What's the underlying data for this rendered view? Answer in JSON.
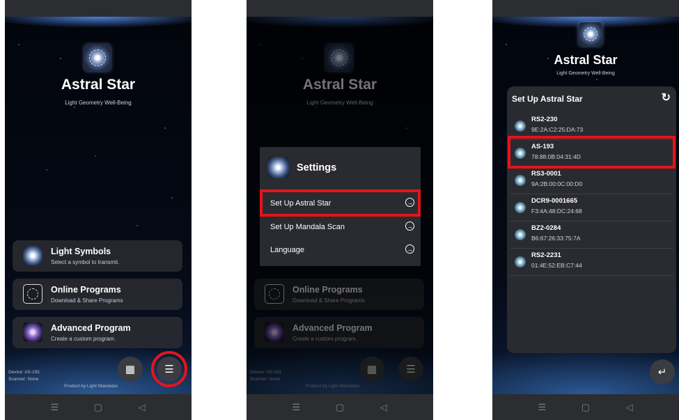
{
  "app": {
    "title": "Astral Star",
    "subtitle": "Light Geometry Well-Being"
  },
  "cards": [
    {
      "title": "Light Symbols",
      "subtitle": "Select a symbol to transmit."
    },
    {
      "title": "Online Programs",
      "subtitle": "Download & Share Programs"
    },
    {
      "title": "Advanced Program",
      "subtitle": "Create a custom program."
    }
  ],
  "footer": {
    "device": "Device: AS-193",
    "scanner": "Scanner: None",
    "product": "Product by Light Mandalas"
  },
  "icons": {
    "store": "store-icon",
    "settings": "sliders-icon",
    "refresh": "refresh-icon",
    "back": "return-icon"
  },
  "settings_menu": {
    "title": "Settings",
    "items": [
      {
        "label": "Set Up Astral Star"
      },
      {
        "label": "Set Up Mandala Scan"
      },
      {
        "label": "Language"
      }
    ]
  },
  "device_setup": {
    "title": "Set Up Astral Star",
    "devices": [
      {
        "name": "RS2-230",
        "mac": "9E:2A:C2:25:DA:73"
      },
      {
        "name": "AS-193",
        "mac": "78:88:0B:04:31:4D"
      },
      {
        "name": "RS3-0001",
        "mac": "9A:2B:00:0C:00:D0"
      },
      {
        "name": "DCR9-0001665",
        "mac": "F3:4A:48:DC:24:68"
      },
      {
        "name": "BZ2-0284",
        "mac": "B6:67:26:33:75:7A"
      },
      {
        "name": "RS2-2231",
        "mac": "01:4E:52:EB:C7:44"
      }
    ]
  },
  "nav": {
    "menu": "☰",
    "home": "▢",
    "back": "◁"
  },
  "colors": {
    "highlight": "#e5141b",
    "panel": "#2a2b30",
    "background": "#070b14"
  }
}
